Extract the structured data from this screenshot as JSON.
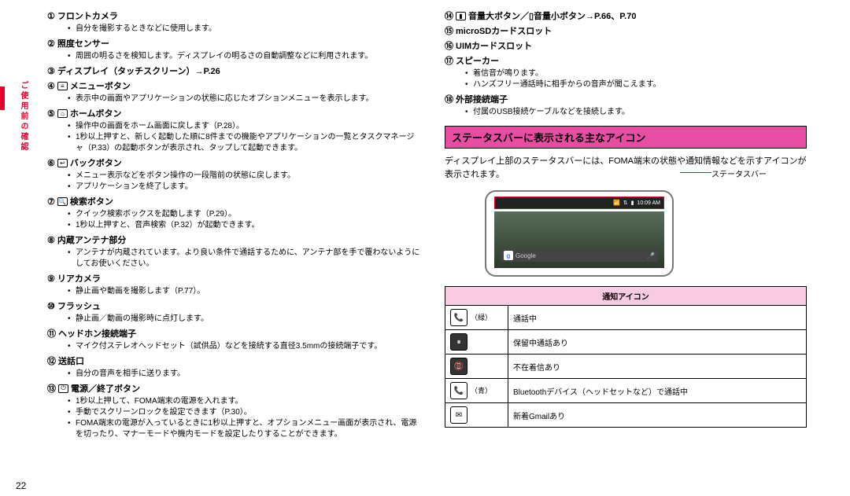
{
  "side_tab": "ご使用前の確認",
  "page_number": "22",
  "left_items": [
    {
      "n": "①",
      "icon": "",
      "title": "フロントカメラ",
      "bullets": [
        "自分を撮影するときなどに使用します。"
      ]
    },
    {
      "n": "②",
      "icon": "",
      "title": "照度センサー",
      "bullets": [
        "周囲の明るさを検知します。ディスプレイの明るさの自動調整などに利用されます。"
      ]
    },
    {
      "n": "③",
      "icon": "",
      "title": "ディスプレイ（タッチスクリーン）→P.26",
      "bullets": []
    },
    {
      "n": "④",
      "icon": "≡",
      "title": "メニューボタン",
      "bullets": [
        "表示中の画面やアプリケーションの状態に応じたオプションメニューを表示します。"
      ]
    },
    {
      "n": "⑤",
      "icon": "⌂",
      "title": "ホームボタン",
      "bullets": [
        "操作中の画面をホーム画面に戻します（P.28）。",
        "1秒以上押すと、新しく起動した順に8件までの機能やアプリケーションの一覧とタスクマネージャ（P.33）の起動ボタンが表示され、タップして起動できます。"
      ]
    },
    {
      "n": "⑥",
      "icon": "↩",
      "title": "バックボタン",
      "bullets": [
        "メニュー表示などをボタン操作の一段階前の状態に戻します。",
        "アプリケーションを終了します。"
      ]
    },
    {
      "n": "⑦",
      "icon": "🔍",
      "title": "検索ボタン",
      "bullets": [
        "クイック検索ボックスを起動します（P.29）。",
        "1秒以上押すと、音声検索（P.32）が起動できます。"
      ]
    },
    {
      "n": "⑧",
      "icon": "",
      "title": "内蔵アンテナ部分",
      "bullets": [
        "アンテナが内蔵されています。より良い条件で通話するために、アンテナ部を手で覆わないようにしてお使いください。"
      ]
    },
    {
      "n": "⑨",
      "icon": "",
      "title": "リアカメラ",
      "bullets": [
        "静止画や動画を撮影します（P.77）。"
      ]
    },
    {
      "n": "⑩",
      "icon": "",
      "title": "フラッシュ",
      "bullets": [
        "静止画／動画の撮影時に点灯します。"
      ]
    },
    {
      "n": "⑪",
      "icon": "",
      "title": "ヘッドホン接続端子",
      "bullets": [
        "マイク付ステレオヘッドセット（試供品）などを接続する直径3.5mmの接続端子です。"
      ]
    },
    {
      "n": "⑫",
      "icon": "",
      "title": "送話口",
      "bullets": [
        "自分の音声を相手に送ります。"
      ]
    },
    {
      "n": "⑬",
      "icon": "⏻",
      "title": "電源／終了ボタン",
      "bullets": [
        "1秒以上押して、FOMA端末の電源を入れます。",
        "手動でスクリーンロックを設定できます（P.30）。",
        "FOMA端末の電源が入っているときに1秒以上押すと、オプションメニュー画面が表示され、電源を切ったり、マナーモードや機内モードを設定したりすることができます。"
      ]
    }
  ],
  "right_items": [
    {
      "n": "⑭",
      "icon": "▮",
      "title": "音量大ボタン／▯音量小ボタン→P.66、P.70",
      "bullets": []
    },
    {
      "n": "⑮",
      "icon": "",
      "title": "microSDカードスロット",
      "bullets": []
    },
    {
      "n": "⑯",
      "icon": "",
      "title": "UIMカードスロット",
      "bullets": []
    },
    {
      "n": "⑰",
      "icon": "",
      "title": "スピーカー",
      "bullets": [
        "着信音が鳴ります。",
        "ハンズフリー通話時に相手からの音声が聞こえます。"
      ]
    },
    {
      "n": "⑱",
      "icon": "",
      "title": "外部接続端子",
      "bullets": [
        "付属のUSB接続ケーブルなどを接続します。"
      ]
    }
  ],
  "section_title": "ステータスバーに表示される主なアイコン",
  "section_para": "ディスプレイ上部のステータスバーには、FOMA端末の状態や通知情報などを示すアイコンが表示されます。",
  "statusbar_label": "ステータスバー",
  "statusbar_time": "10:09 AM",
  "search_placeholder": "Google",
  "table_header": "通知アイコン",
  "table_rows": [
    {
      "icon": "phone-green",
      "color_note": "（緑）",
      "desc": "通話中"
    },
    {
      "icon": "phone-hold",
      "color_note": "",
      "desc": "保留中通話あり"
    },
    {
      "icon": "phone-missed",
      "color_note": "",
      "desc": "不在着信あり"
    },
    {
      "icon": "phone-bt",
      "color_note": "（青）",
      "desc": "Bluetoothデバイス（ヘッドセットなど）で通話中"
    },
    {
      "icon": "gmail",
      "color_note": "",
      "desc": "新着Gmailあり"
    }
  ]
}
